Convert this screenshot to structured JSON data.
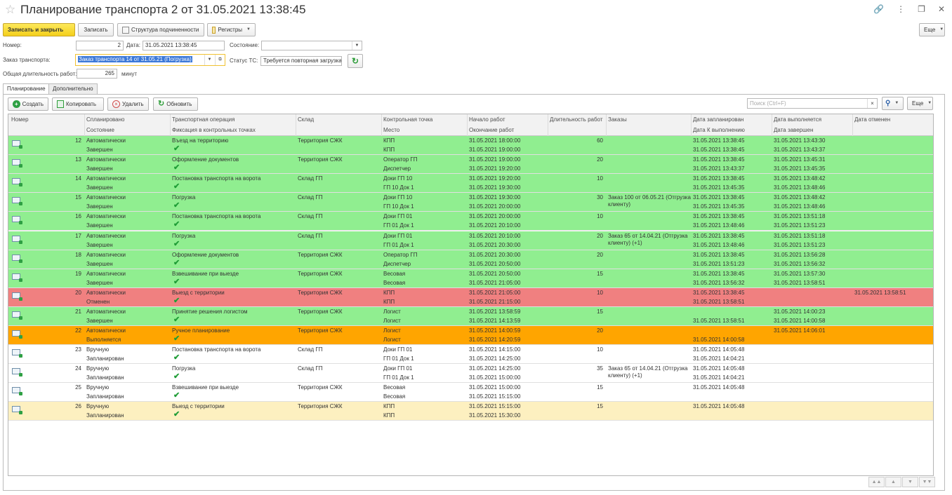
{
  "window": {
    "title": "Планирование транспорта 2 от 31.05.2021 13:38:45",
    "star": "☆",
    "link_icon": "link-icon",
    "more_icon": "more-vertical-icon",
    "restore_icon": "restore-window-icon",
    "close_icon": "close-icon"
  },
  "toolbar": {
    "save_close": "Записать и закрыть",
    "save": "Записать",
    "structure": "Структура подчиненности",
    "registers": "Регистры",
    "more": "Еще"
  },
  "form": {
    "number_label": "Номер:",
    "number_value": "2",
    "date_label": "Дата:",
    "date_value": "31.05.2021 13:38:45",
    "state_label": "Состояние:",
    "state_value": "",
    "order_label": "Заказ транспорта:",
    "order_value": "Заказ транспорта 14 от 31.05.21 (Погрузка)",
    "vehicle_status_label": "Статус ТС:",
    "vehicle_status_value": "Требуется повторная загрузка",
    "duration_label": "Общая длительность работ:",
    "duration_value": "265",
    "duration_unit": "минут"
  },
  "tabs": [
    {
      "label": "Планирование",
      "active": true
    },
    {
      "label": "Дополнительно",
      "active": false
    }
  ],
  "table_toolbar": {
    "create": "Создать",
    "copy": "Копировать",
    "delete": "Удалить",
    "refresh": "Обновить",
    "search_placeholder": "Поиск (Ctrl+F)",
    "more": "Еще"
  },
  "columns": {
    "c1": [
      "Номер",
      ""
    ],
    "c2": [
      "Спланировано",
      "Состояние"
    ],
    "c3": [
      "Транспортная операция",
      "Фиксация в контрольных точках"
    ],
    "c4": [
      "Склад",
      ""
    ],
    "c5": [
      "Контрольная точка",
      "Место"
    ],
    "c6": [
      "Начало работ",
      "Окончание работ"
    ],
    "c7": [
      "Длительность работ",
      ""
    ],
    "c8": [
      "Заказы",
      ""
    ],
    "c9": [
      "Дата запланирован",
      "Дата К выполнению"
    ],
    "c10": [
      "Дата выполняется",
      "Дата завершен"
    ],
    "c11": [
      "Дата отменен",
      ""
    ]
  },
  "colors": {
    "green": "#90ee90",
    "red": "#f08080",
    "orange": "#ffa500",
    "white": "#ffffff",
    "cream": "#fdf0c0"
  },
  "rows": [
    {
      "num": "12",
      "planned": "Автоматически",
      "state": "Завершен",
      "op": "Въезд на территорию",
      "wh": "Территория СЖК",
      "cp": "КПП",
      "place": "КПП",
      "start": "31.05.2021 18:00:00",
      "end": "31.05.2021 19:00:00",
      "dur": "60",
      "orders": "",
      "d_plan": "31.05.2021 13:38:45",
      "d_todo": "31.05.2021 13:38:45",
      "d_exec": "31.05.2021 13:43:30",
      "d_done": "31.05.2021 13:43:37",
      "d_cancel": "",
      "color": "green"
    },
    {
      "num": "13",
      "planned": "Автоматически",
      "state": "Завершен",
      "op": "Оформление документов",
      "wh": "Территория СЖК",
      "cp": "Оператор ГП",
      "place": "Диспетчер",
      "start": "31.05.2021 19:00:00",
      "end": "31.05.2021 19:20:00",
      "dur": "20",
      "orders": "",
      "d_plan": "31.05.2021 13:38:45",
      "d_todo": "31.05.2021 13:43:37",
      "d_exec": "31.05.2021 13:45:31",
      "d_done": "31.05.2021 13:45:35",
      "d_cancel": "",
      "color": "green"
    },
    {
      "num": "14",
      "planned": "Автоматически",
      "state": "Завершен",
      "op": "Постановка транспорта на ворота",
      "wh": "Склад ГП",
      "cp": "Доки ГП 10",
      "place": "ГП 10 Док 1",
      "start": "31.05.2021 19:20:00",
      "end": "31.05.2021 19:30:00",
      "dur": "10",
      "orders": "",
      "d_plan": "31.05.2021 13:38:45",
      "d_todo": "31.05.2021 13:45:35",
      "d_exec": "31.05.2021 13:48:42",
      "d_done": "31.05.2021 13:48:46",
      "d_cancel": "",
      "color": "green"
    },
    {
      "num": "15",
      "planned": "Автоматически",
      "state": "Завершен",
      "op": "Погрузка",
      "wh": "Склад ГП",
      "cp": "Доки ГП 10",
      "place": "ГП 10 Док 1",
      "start": "31.05.2021 19:30:00",
      "end": "31.05.2021 20:00:00",
      "dur": "30",
      "orders": "Заказ 100 от 06.05.21 (Отгрузка клиенту)",
      "d_plan": "31.05.2021 13:38:45",
      "d_todo": "31.05.2021 13:45:35",
      "d_exec": "31.05.2021 13:48:42",
      "d_done": "31.05.2021 13:48:46",
      "d_cancel": "",
      "color": "green"
    },
    {
      "num": "16",
      "planned": "Автоматически",
      "state": "Завершен",
      "op": "Постановка транспорта на ворота",
      "wh": "Склад ГП",
      "cp": "Доки ГП 01",
      "place": "ГП 01 Док 1",
      "start": "31.05.2021 20:00:00",
      "end": "31.05.2021 20:10:00",
      "dur": "10",
      "orders": "",
      "d_plan": "31.05.2021 13:38:45",
      "d_todo": "31.05.2021 13:48:46",
      "d_exec": "31.05.2021 13:51:18",
      "d_done": "31.05.2021 13:51:23",
      "d_cancel": "",
      "color": "green"
    },
    {
      "num": "17",
      "planned": "Автоматически",
      "state": "Завершен",
      "op": "Погрузка",
      "wh": "Склад ГП",
      "cp": "Доки ГП 01",
      "place": "ГП 01 Док 1",
      "start": "31.05.2021 20:10:00",
      "end": "31.05.2021 20:30:00",
      "dur": "20",
      "orders": "Заказ 65 от 14.04.21 (Отгрузка клиенту) (+1)",
      "d_plan": "31.05.2021 13:38:45",
      "d_todo": "31.05.2021 13:48:46",
      "d_exec": "31.05.2021 13:51:18",
      "d_done": "31.05.2021 13:51:23",
      "d_cancel": "",
      "color": "green"
    },
    {
      "num": "18",
      "planned": "Автоматически",
      "state": "Завершен",
      "op": "Оформление документов",
      "wh": "Территория СЖК",
      "cp": "Оператор ГП",
      "place": "Диспетчер",
      "start": "31.05.2021 20:30:00",
      "end": "31.05.2021 20:50:00",
      "dur": "20",
      "orders": "",
      "d_plan": "31.05.2021 13:38:45",
      "d_todo": "31.05.2021 13:51:23",
      "d_exec": "31.05.2021 13:56:28",
      "d_done": "31.05.2021 13:56:32",
      "d_cancel": "",
      "color": "green"
    },
    {
      "num": "19",
      "planned": "Автоматически",
      "state": "Завершен",
      "op": "Взвешивание при выезде",
      "wh": "Территория СЖК",
      "cp": "Весовая",
      "place": "Весовая",
      "start": "31.05.2021 20:50:00",
      "end": "31.05.2021 21:05:00",
      "dur": "15",
      "orders": "",
      "d_plan": "31.05.2021 13:38:45",
      "d_todo": "31.05.2021 13:56:32",
      "d_exec": "31.05.2021 13:57:30",
      "d_done": "31.05.2021 13:58:51",
      "d_cancel": "",
      "color": "green"
    },
    {
      "num": "20",
      "planned": "Автоматически",
      "state": "Отменен",
      "op": "Выезд с территории",
      "wh": "Территория СЖК",
      "cp": "КПП",
      "place": "КПП",
      "start": "31.05.2021 21:05:00",
      "end": "31.05.2021 21:15:00",
      "dur": "10",
      "orders": "",
      "d_plan": "31.05.2021 13:38:45",
      "d_todo": "31.05.2021 13:58:51",
      "d_exec": "",
      "d_done": "",
      "d_cancel": "31.05.2021 13:58:51",
      "color": "red"
    },
    {
      "num": "21",
      "planned": "Автоматически",
      "state": "Завершен",
      "op": "Принятие решения логистом",
      "wh": "Территория СЖК",
      "cp": "Логист",
      "place": "Логист",
      "start": "31.05.2021 13:58:59",
      "end": "31.05.2021 14:13:59",
      "dur": "15",
      "orders": "",
      "d_plan": "",
      "d_todo": "31.05.2021 13:58:51",
      "d_exec": "31.05.2021 14:00:23",
      "d_done": "31.05.2021 14:00:58",
      "d_cancel": "",
      "color": "green"
    },
    {
      "num": "22",
      "planned": "Автоматически",
      "state": "Выполняется",
      "op": "Ручное планирование",
      "wh": "Территория СЖК",
      "cp": "Логист",
      "place": "Логист",
      "start": "31.05.2021 14:00:59",
      "end": "31.05.2021 14:20:59",
      "dur": "20",
      "orders": "",
      "d_plan": "",
      "d_todo": "31.05.2021 14:00:58",
      "d_exec": "31.05.2021 14:06:01",
      "d_done": "",
      "d_cancel": "",
      "color": "orange"
    },
    {
      "num": "23",
      "planned": "Вручную",
      "state": "Запланирован",
      "op": "Постановка транспорта на ворота",
      "wh": "Склад ГП",
      "cp": "Доки ГП 01",
      "place": "ГП 01 Док 1",
      "start": "31.05.2021 14:15:00",
      "end": "31.05.2021 14:25:00",
      "dur": "10",
      "orders": "",
      "d_plan": "31.05.2021 14:05:48",
      "d_todo": "31.05.2021 14:04:21",
      "d_exec": "",
      "d_done": "",
      "d_cancel": "",
      "color": "white"
    },
    {
      "num": "24",
      "planned": "Вручную",
      "state": "Запланирован",
      "op": "Погрузка",
      "wh": "Склад ГП",
      "cp": "Доки ГП 01",
      "place": "ГП 01 Док 1",
      "start": "31.05.2021 14:25:00",
      "end": "31.05.2021 15:00:00",
      "dur": "35",
      "orders": "Заказ 65 от 14.04.21 (Отгрузка клиенту) (+1)",
      "d_plan": "31.05.2021 14:05:48",
      "d_todo": "31.05.2021 14:04:21",
      "d_exec": "",
      "d_done": "",
      "d_cancel": "",
      "color": "white"
    },
    {
      "num": "25",
      "planned": "Вручную",
      "state": "Запланирован",
      "op": "Взвешивание при выезде",
      "wh": "Территория СЖК",
      "cp": "Весовая",
      "place": "Весовая",
      "start": "31.05.2021 15:00:00",
      "end": "31.05.2021 15:15:00",
      "dur": "15",
      "orders": "",
      "d_plan": "31.05.2021 14:05:48",
      "d_todo": "",
      "d_exec": "",
      "d_done": "",
      "d_cancel": "",
      "color": "white"
    },
    {
      "num": "26",
      "planned": "Вручную",
      "state": "Запланирован",
      "op": "Выезд с территории",
      "wh": "Территория СЖК",
      "cp": "КПП",
      "place": "КПП",
      "start": "31.05.2021 15:15:00",
      "end": "31.05.2021 15:30:00",
      "dur": "15",
      "orders": "",
      "d_plan": "31.05.2021 14:05:48",
      "d_todo": "",
      "d_exec": "",
      "d_done": "",
      "d_cancel": "",
      "color": "cream"
    }
  ]
}
